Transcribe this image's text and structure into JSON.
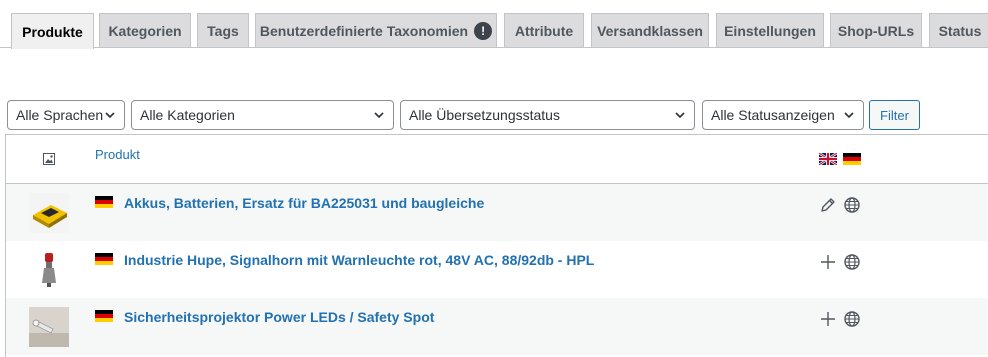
{
  "tabs": [
    {
      "label": "Produkte",
      "active": true
    },
    {
      "label": "Kategorien"
    },
    {
      "label": "Tags"
    },
    {
      "label": "Benutzerdefinierte Taxonomien",
      "badge": "!"
    },
    {
      "label": "Attribute"
    },
    {
      "label": "Versandklassen"
    },
    {
      "label": "Einstellungen"
    },
    {
      "label": "Shop-URLs"
    },
    {
      "label": "Status"
    }
  ],
  "filters": {
    "languages": "Alle Sprachen",
    "categories": "Alle Kategorien",
    "translation_status": "Alle Übersetzungsstatus",
    "status_display": "Alle Statusanzeigen",
    "button": "Filter"
  },
  "table": {
    "header_product": "Produkt",
    "header_thumb_icon": "image-icon",
    "header_flags": [
      "flag-gb-icon",
      "flag-de-icon"
    ],
    "rows": [
      {
        "title": "Akkus, Batterien, Ersatz für BA225031 und baugleiche",
        "flag": "flag-de-icon",
        "actions": [
          "pencil-icon",
          "globe-icon"
        ]
      },
      {
        "title": "Industrie Hupe, Signalhorn mit Warnleuchte rot, 48V AC, 88/92db - HPL",
        "flag": "flag-de-icon",
        "actions": [
          "plus-icon",
          "globe-icon"
        ]
      },
      {
        "title": "Sicherheitsprojektor Power LEDs / Safety Spot",
        "flag": "flag-de-icon",
        "actions": [
          "plus-icon",
          "globe-icon"
        ]
      }
    ]
  },
  "colors": {
    "link": "#2271b1",
    "tab_bg": "#dcdcde",
    "row_alt": "#f6f7f7"
  }
}
